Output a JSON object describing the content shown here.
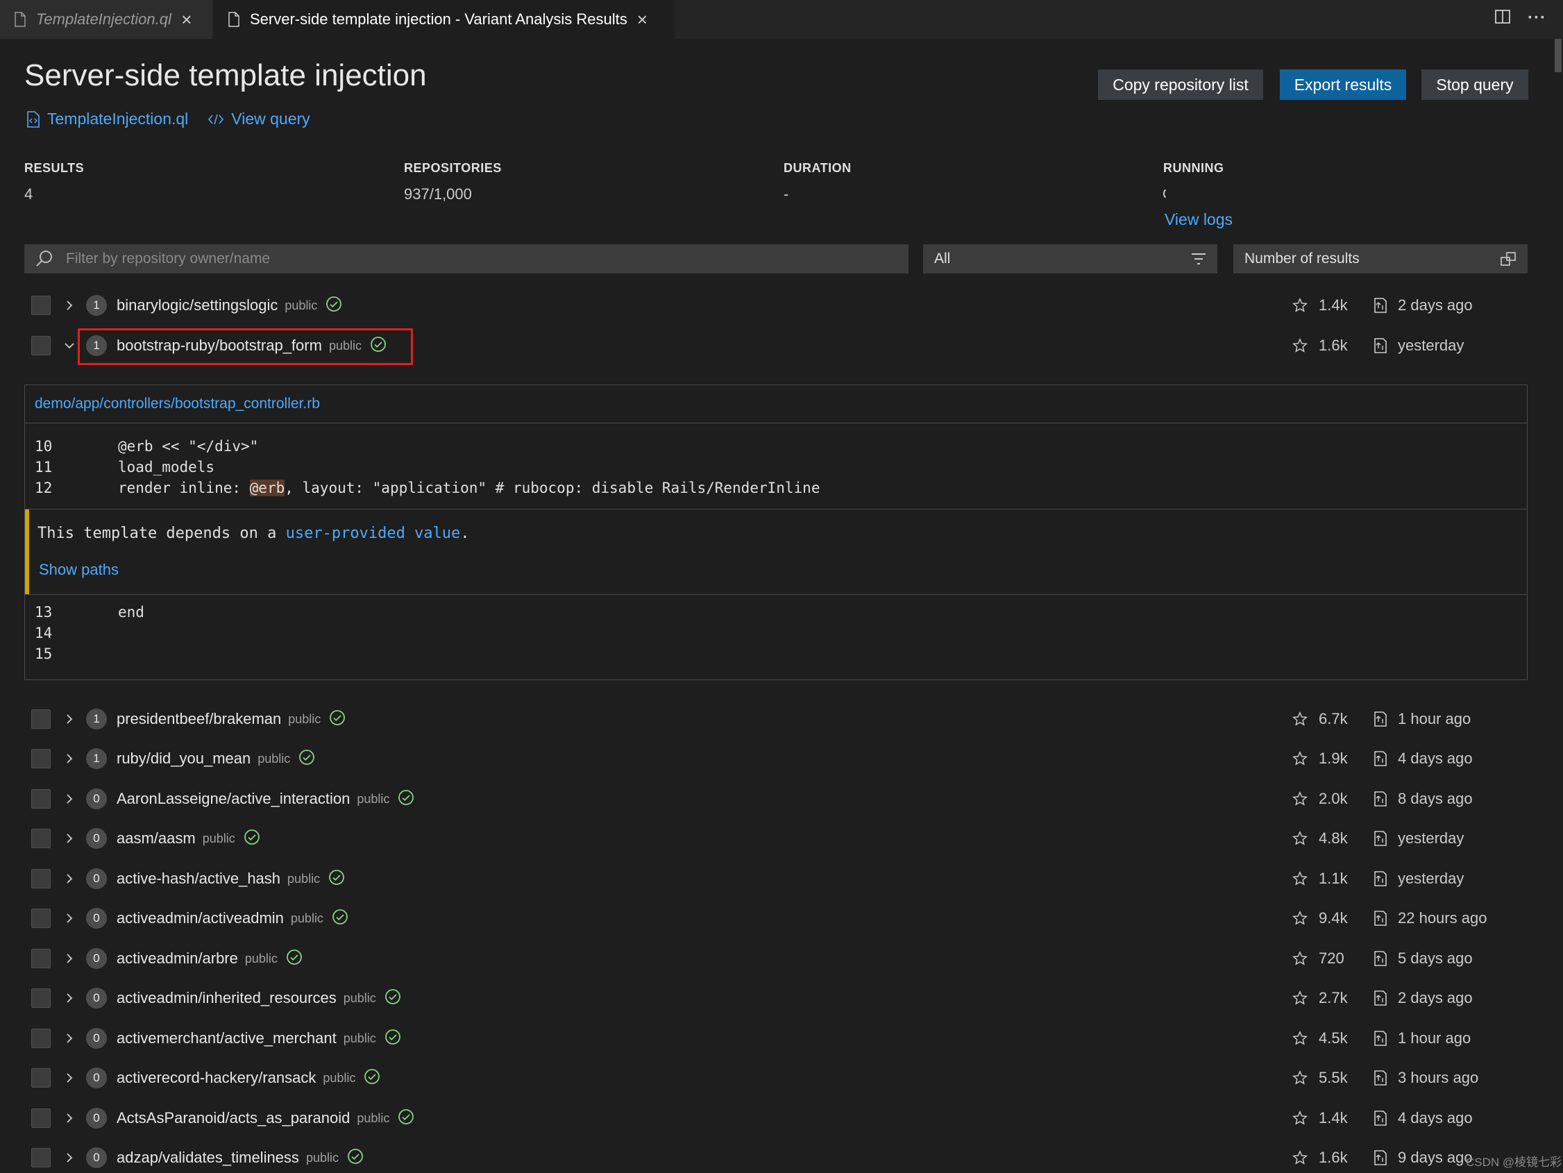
{
  "tabs": [
    {
      "label": "TemplateInjection.ql"
    },
    {
      "label": "Server-side template injection - Variant Analysis Results"
    }
  ],
  "header": {
    "title": "Server-side template injection",
    "query_file_link": "TemplateInjection.ql",
    "view_query_link": "View query",
    "buttons": {
      "copy_repo_list": "Copy repository list",
      "export_results": "Export results",
      "stop_query": "Stop query"
    }
  },
  "stats": {
    "results": {
      "label": "RESULTS",
      "value": "4"
    },
    "repositories": {
      "label": "REPOSITORIES",
      "value": "937/1,000"
    },
    "duration": {
      "label": "DURATION",
      "value": "-"
    },
    "running": {
      "label": "RUNNING",
      "link": "View logs"
    }
  },
  "filter": {
    "placeholder": "Filter by repository owner/name",
    "result_filter": "All",
    "sort": "Number of results"
  },
  "expanded": {
    "file_path": "demo/app/controllers/bootstrap_controller.rb",
    "lines_before": [
      {
        "num": "10",
        "code": "@erb << \"</div>\""
      },
      {
        "num": "11",
        "code": "load_models"
      },
      {
        "num": "12",
        "code_pre": "render inline: ",
        "code_hl": "@erb",
        "code_post": ", layout: \"application\" # rubocop: disable Rails/RenderInline"
      }
    ],
    "message_pre": "This template depends on a ",
    "message_link": "user-provided value",
    "message_post": ".",
    "show_paths": "Show paths",
    "lines_after": [
      {
        "num": "13",
        "code": "end"
      },
      {
        "num": "14",
        "code": ""
      },
      {
        "num": "15",
        "code": ""
      }
    ]
  },
  "repos": [
    {
      "count": "1",
      "name": "binarylogic/settingslogic",
      "visibility": "public",
      "stars": "1.4k",
      "updated": "2 days ago",
      "expanded": false
    },
    {
      "count": "1",
      "name": "bootstrap-ruby/bootstrap_form",
      "visibility": "public",
      "stars": "1.6k",
      "updated": "yesterday",
      "expanded": true
    },
    {
      "count": "1",
      "name": "presidentbeef/brakeman",
      "visibility": "public",
      "stars": "6.7k",
      "updated": "1 hour ago",
      "expanded": false
    },
    {
      "count": "1",
      "name": "ruby/did_you_mean",
      "visibility": "public",
      "stars": "1.9k",
      "updated": "4 days ago",
      "expanded": false
    },
    {
      "count": "0",
      "name": "AaronLasseigne/active_interaction",
      "visibility": "public",
      "stars": "2.0k",
      "updated": "8 days ago",
      "expanded": false
    },
    {
      "count": "0",
      "name": "aasm/aasm",
      "visibility": "public",
      "stars": "4.8k",
      "updated": "yesterday",
      "expanded": false
    },
    {
      "count": "0",
      "name": "active-hash/active_hash",
      "visibility": "public",
      "stars": "1.1k",
      "updated": "yesterday",
      "expanded": false
    },
    {
      "count": "0",
      "name": "activeadmin/activeadmin",
      "visibility": "public",
      "stars": "9.4k",
      "updated": "22 hours ago",
      "expanded": false
    },
    {
      "count": "0",
      "name": "activeadmin/arbre",
      "visibility": "public",
      "stars": "720",
      "updated": "5 days ago",
      "expanded": false
    },
    {
      "count": "0",
      "name": "activeadmin/inherited_resources",
      "visibility": "public",
      "stars": "2.7k",
      "updated": "2 days ago",
      "expanded": false
    },
    {
      "count": "0",
      "name": "activemerchant/active_merchant",
      "visibility": "public",
      "stars": "4.5k",
      "updated": "1 hour ago",
      "expanded": false
    },
    {
      "count": "0",
      "name": "activerecord-hackery/ransack",
      "visibility": "public",
      "stars": "5.5k",
      "updated": "3 hours ago",
      "expanded": false
    },
    {
      "count": "0",
      "name": "ActsAsParanoid/acts_as_paranoid",
      "visibility": "public",
      "stars": "1.4k",
      "updated": "4 days ago",
      "expanded": false
    },
    {
      "count": "0",
      "name": "adzap/validates_timeliness",
      "visibility": "public",
      "stars": "1.6k",
      "updated": "9 days ago",
      "expanded": false
    }
  ],
  "watermark": "CSDN @棱镜七彩",
  "colors": {
    "accent": "#0e639c",
    "link": "#4daafc",
    "success": "#89d185",
    "highlight_border": "#e0201b",
    "warning_bar": "#cca700"
  }
}
